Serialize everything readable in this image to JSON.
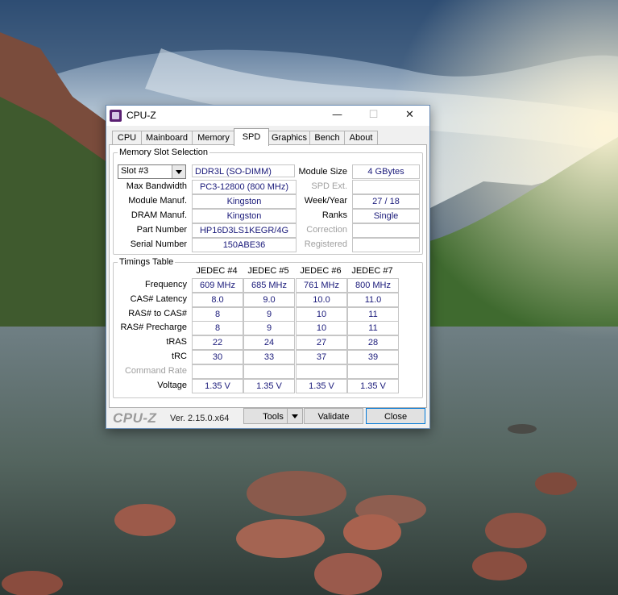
{
  "window": {
    "title": "CPU-Z",
    "controls": {
      "minimize": "—",
      "maximize": "☐",
      "close": "✕"
    }
  },
  "tabs": [
    {
      "label": "CPU",
      "active": false
    },
    {
      "label": "Mainboard",
      "active": false
    },
    {
      "label": "Memory",
      "active": false
    },
    {
      "label": "SPD",
      "active": true
    },
    {
      "label": "Graphics",
      "active": false
    },
    {
      "label": "Bench",
      "active": false
    },
    {
      "label": "About",
      "active": false
    }
  ],
  "memory_slot": {
    "group_title": "Memory Slot Selection",
    "slot_value": "Slot #3",
    "memory_type": "DDR3L (SO-DIMM)",
    "labels": {
      "max_bandwidth": "Max Bandwidth",
      "module_manuf": "Module Manuf.",
      "dram_manuf": "DRAM Manuf.",
      "part_number": "Part Number",
      "serial_number": "Serial Number",
      "module_size": "Module Size",
      "spd_ext": "SPD Ext.",
      "week_year": "Week/Year",
      "ranks": "Ranks",
      "correction": "Correction",
      "registered": "Registered"
    },
    "values": {
      "max_bandwidth": "PC3-12800 (800 MHz)",
      "module_manuf": "Kingston",
      "dram_manuf": "Kingston",
      "part_number": "HP16D3LS1KEGR/4G",
      "serial_number": "150ABE36",
      "module_size": "4 GBytes",
      "spd_ext": "",
      "week_year": "27 / 18",
      "ranks": "Single",
      "correction": "",
      "registered": ""
    }
  },
  "timings": {
    "group_title": "Timings Table",
    "columns": [
      "JEDEC #4",
      "JEDEC #5",
      "JEDEC #6",
      "JEDEC #7"
    ],
    "rows": [
      {
        "label": "Frequency",
        "values": [
          "609 MHz",
          "685 MHz",
          "761 MHz",
          "800 MHz"
        ]
      },
      {
        "label": "CAS# Latency",
        "values": [
          "8.0",
          "9.0",
          "10.0",
          "11.0"
        ]
      },
      {
        "label": "RAS# to CAS#",
        "values": [
          "8",
          "9",
          "10",
          "11"
        ]
      },
      {
        "label": "RAS# Precharge",
        "values": [
          "8",
          "9",
          "10",
          "11"
        ]
      },
      {
        "label": "tRAS",
        "values": [
          "22",
          "24",
          "27",
          "28"
        ]
      },
      {
        "label": "tRC",
        "values": [
          "30",
          "33",
          "37",
          "39"
        ]
      },
      {
        "label": "Command Rate",
        "values": [
          "",
          "",
          "",
          ""
        ],
        "dim": true
      },
      {
        "label": "Voltage",
        "values": [
          "1.35 V",
          "1.35 V",
          "1.35 V",
          "1.35 V"
        ]
      }
    ]
  },
  "footer": {
    "brand": "CPU-Z",
    "version": "Ver. 2.15.0.x64",
    "tools_label": "Tools",
    "validate_label": "Validate",
    "close_label": "Close"
  }
}
